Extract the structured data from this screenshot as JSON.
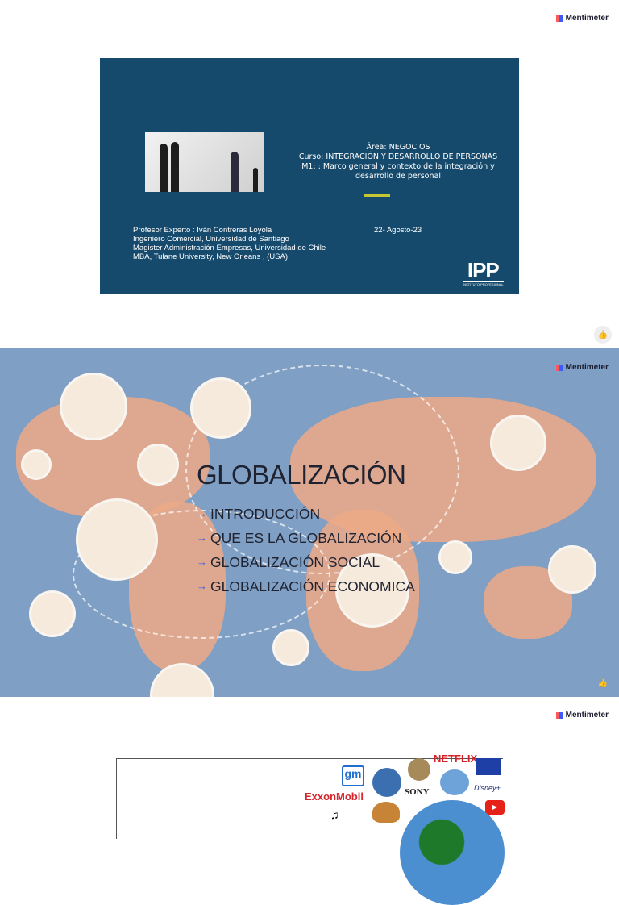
{
  "brand": "Mentimeter",
  "slide1": {
    "area": "Área: NEGOCIOS",
    "curso": "Curso: INTEGRACIÓN Y DESARROLLO DE PERSONAS",
    "modulo": "M1: : Marco general y contexto de la integración y desarrollo de personal",
    "profesor": [
      "Profesor Experto : Iván Contreras Loyola",
      "Ingeniero Comercial, Universidad de Santiago",
      "Magister Administración Empresas, Universidad de Chile",
      "MBA, Tulane University, New Orleans , (USA)"
    ],
    "date": "22- Agosto-23",
    "logo": "IPP",
    "logo_sub": "INSTITUTO PROFESIONAL"
  },
  "slide2": {
    "title": "GLOBALIZACIÓN",
    "items": [
      "INTRODUCCIÓN",
      "QUE ES LA GLOBALIZACIÓN",
      "GLOBALIZACIÓN SOCIAL",
      "GLOBALIZACIÓN ECONOMICA"
    ],
    "arrow": "→"
  },
  "slide3": {
    "logos": {
      "gm": "gm",
      "exxon": "ExxonMobil",
      "netflix": "NETFLIX",
      "sony": "SONY",
      "disney": "Disney+"
    }
  },
  "like_icon": "thumbs-up-icon"
}
